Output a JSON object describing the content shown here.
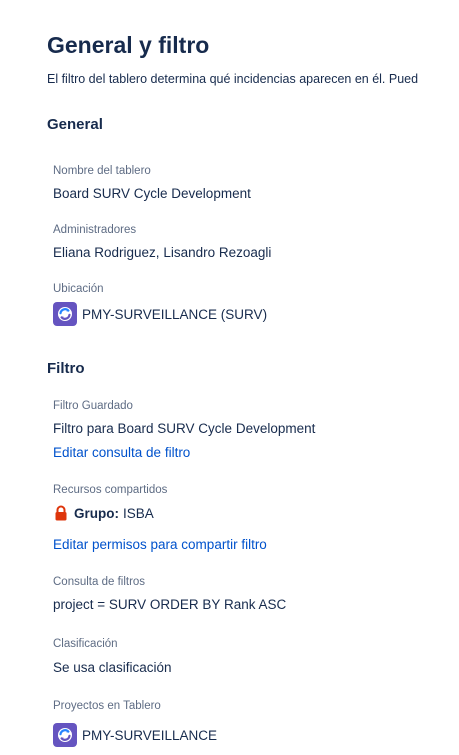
{
  "header": {
    "title": "General y filtro",
    "intro": "El filtro del tablero determina qué incidencias aparecen en él. Pued"
  },
  "general": {
    "section_title": "General",
    "board_name_label": "Nombre del tablero",
    "board_name_value": "Board SURV Cycle Development",
    "admins_label": "Administradores",
    "admins_value": "Eliana Rodriguez, Lisandro Rezoagli",
    "location_label": "Ubicación",
    "location_value": "PMY-SURVEILLANCE (SURV)",
    "location_icon": "project-avatar-icon"
  },
  "filter": {
    "section_title": "Filtro",
    "saved_filter_label": "Filtro Guardado",
    "saved_filter_value": "Filtro para Board SURV Cycle Development",
    "edit_query_link": "Editar consulta de filtro",
    "shares_label": "Recursos compartidos",
    "shares_group_label": "Grupo:",
    "shares_group_value": "ISBA",
    "shares_icon": "lock-icon",
    "edit_permissions_link": "Editar permisos para compartir filtro",
    "query_label": "Consulta de filtros",
    "query_value": "project = SURV ORDER BY Rank ASC",
    "ranking_label": "Clasificación",
    "ranking_value": "Se usa clasificación",
    "projects_label": "Proyectos en Tablero",
    "projects_value": "PMY-SURVEILLANCE",
    "projects_icon": "project-avatar-icon"
  },
  "colors": {
    "text": "#172b4d",
    "label": "#5e6c84",
    "link": "#0052cc",
    "avatar": "#6554c0",
    "lock": "#de350b"
  }
}
